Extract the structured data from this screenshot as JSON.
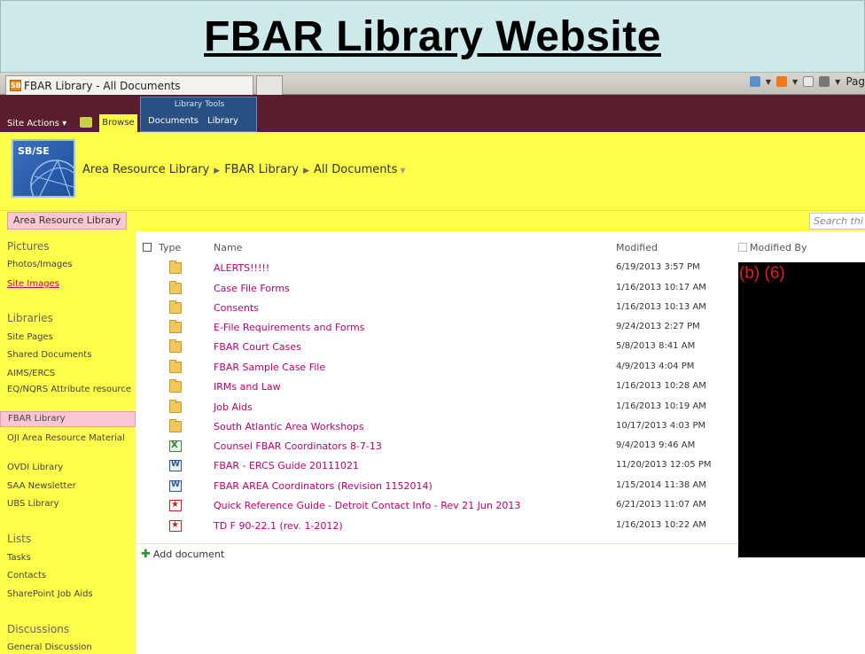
{
  "slide": {
    "title": "FBAR Library Website"
  },
  "browser": {
    "tab_title": "FBAR Library - All Documents",
    "favicon_label": "SB",
    "command_bar": {
      "page_label": "Pag",
      "icons": [
        "home-icon",
        "rss-icon",
        "mail-icon",
        "print-icon"
      ]
    }
  },
  "ribbon": {
    "site_actions": "Site Actions ▾",
    "browse": "Browse",
    "tools_group": "Library Tools",
    "tab_documents": "Documents",
    "tab_library": "Library"
  },
  "header": {
    "logo_text": "SB/SE",
    "breadcrumb": [
      "Area Resource Library",
      "FBAR Library",
      "All Documents"
    ]
  },
  "topnav": {
    "home": "Area Resource Library",
    "search_placeholder": "Search thi"
  },
  "sidebar": {
    "sections": [
      {
        "heading": "Pictures",
        "items": [
          {
            "label": "Photos/Images"
          },
          {
            "label": "Site Images"
          }
        ]
      },
      {
        "heading": "Libraries",
        "items": [
          {
            "label": "Site Pages"
          },
          {
            "label": "Shared Documents"
          },
          {
            "label": "AIMS/ERCS"
          },
          {
            "label": "EQ/NQRS Attribute resource"
          },
          {
            "label": "FBAR Library"
          },
          {
            "label": "OJI Area Resource Material"
          },
          {
            "label": "OVDI Library"
          },
          {
            "label": "SAA Newsletter"
          },
          {
            "label": "UBS Library"
          }
        ]
      },
      {
        "heading": "Lists",
        "items": [
          {
            "label": "Tasks"
          },
          {
            "label": "Contacts"
          },
          {
            "label": "SharePoint Job Aids"
          }
        ]
      },
      {
        "heading": "Discussions",
        "items": [
          {
            "label": "General Discussion"
          }
        ]
      }
    ]
  },
  "list": {
    "columns": {
      "type": "Type",
      "name": "Name",
      "modified": "Modified",
      "modified_by": "Modified By"
    },
    "rows": [
      {
        "type": "folder-icon",
        "name": "ALERTS!!!!!",
        "modified": "6/19/2013 3:57 PM"
      },
      {
        "type": "folder-icon",
        "name": "Case File Forms",
        "modified": "1/16/2013 10:17 AM"
      },
      {
        "type": "folder-icon",
        "name": "Consents",
        "modified": "1/16/2013 10:13 AM"
      },
      {
        "type": "folder-icon",
        "name": "E-File Requirements and Forms",
        "modified": "9/24/2013 2:27 PM"
      },
      {
        "type": "folder-icon",
        "name": "FBAR Court Cases",
        "modified": "5/8/2013 8:41 AM"
      },
      {
        "type": "folder-icon",
        "name": "FBAR Sample Case File",
        "modified": "4/9/2013 4:04 PM"
      },
      {
        "type": "folder-icon",
        "name": "IRMs and Law",
        "modified": "1/16/2013 10:28 AM"
      },
      {
        "type": "folder-icon",
        "name": "Job Aids",
        "modified": "1/16/2013 10:19 AM"
      },
      {
        "type": "folder-icon",
        "name": "South Atlantic Area Workshops",
        "modified": "10/17/2013 4:03 PM"
      },
      {
        "type": "excel-icon",
        "name": "Counsel FBAR Coordinators 8-7-13",
        "modified": "9/4/2013 9:46 AM"
      },
      {
        "type": "word-icon",
        "name": "FBAR - ERCS Guide 20111021",
        "modified": "11/20/2013 12:05 PM"
      },
      {
        "type": "word-icon",
        "name": "FBAR AREA Coordinators (Revision 1152014)",
        "modified": "1/15/2014 11:38 AM"
      },
      {
        "type": "pdf-icon",
        "name": "Quick Reference Guide - Detroit Contact Info - Rev 21 Jun 2013",
        "modified": "6/21/2013 11:07 AM"
      },
      {
        "type": "pdf-icon",
        "name": "TD F 90-22.1 (rev. 1-2012)",
        "modified": "1/16/2013 10:22 AM"
      }
    ],
    "add_document": "Add document"
  },
  "redaction": {
    "label": "(b) (6)"
  }
}
